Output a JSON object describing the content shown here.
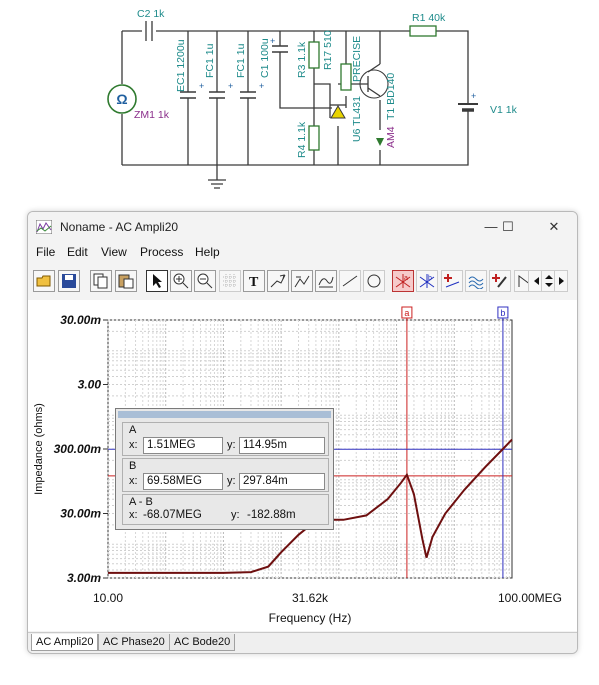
{
  "schematic": {
    "labels": {
      "c2": "C2 1k",
      "r1": "R1 40k",
      "zm1": "ZM1 1k",
      "ec1": "EC1 1200u",
      "fc1a": "FC1 1u",
      "fc1b": "FC1 1u",
      "c1": "C1 100u",
      "r3": "R3 1.1k",
      "r17": "R17 510",
      "precise": "PRECISE",
      "u6": "U6 TL431",
      "t1": "T1 BD140",
      "r4": "R4 1.1k",
      "am4": "AM4",
      "v1": "V1 1k",
      "omega": "Ω"
    }
  },
  "window": {
    "title": "Noname - AC Ampli20",
    "minimize": "—",
    "maximize": "☐",
    "close": "✕"
  },
  "menu": [
    "File",
    "Edit",
    "View",
    "Process",
    "Help"
  ],
  "toolbar_icons": [
    "open-icon",
    "save-icon",
    "copy-icon",
    "paste-icon",
    "pointer-icon",
    "zoom-in-icon",
    "zoom-out-icon",
    "grid-icon",
    "text-icon",
    "draw-icon",
    "draw2-icon",
    "curve-icon",
    "line-icon",
    "circle-icon",
    "cursor-a-icon",
    "cursor-b-icon",
    "marker-icon",
    "wave-icon",
    "probe-icon",
    "step-icon",
    "scroll-left-icon",
    "scroll-updown-icon",
    "scroll-right-icon"
  ],
  "cursor_panel": {
    "a": {
      "label": "A",
      "x_label": "x:",
      "x": "1.51MEG",
      "y_label": "y:",
      "y": "114.95m"
    },
    "b": {
      "label": "B",
      "x_label": "x:",
      "x": "69.58MEG",
      "y_label": "y:",
      "y": "297.84m"
    },
    "diff": {
      "label": "A - B",
      "x_label": "x:",
      "x": "-68.07MEG",
      "y_label": "y:",
      "y": "-182.88m"
    }
  },
  "chart_data": {
    "type": "line",
    "xlabel": "Frequency (Hz)",
    "ylabel": "Impedance (ohms)",
    "xscale": "log",
    "yscale": "log",
    "xlim": [
      10,
      100000000
    ],
    "ylim": [
      0.003,
      30
    ],
    "xticks": [
      {
        "value": 10,
        "label": "10.00"
      },
      {
        "value": 31620,
        "label": "31.62k"
      },
      {
        "value": 100000000,
        "label": "100.00MEG"
      }
    ],
    "yticks": [
      {
        "value": 30,
        "label": "30.00m"
      },
      {
        "value": 3,
        "label": "3.00"
      },
      {
        "value": 0.3,
        "label": "300.00m"
      },
      {
        "value": 0.03,
        "label": "30.00m"
      },
      {
        "value": 0.003,
        "label": "3.00m"
      }
    ],
    "series": [
      {
        "color": "#6e0f0f",
        "points": [
          [
            10,
            0.0036
          ],
          [
            30,
            0.0036
          ],
          [
            100,
            0.0036
          ],
          [
            1000,
            0.0036
          ],
          [
            3000,
            0.0037
          ],
          [
            6000,
            0.0045
          ],
          [
            10000,
            0.0075
          ],
          [
            20000,
            0.014
          ],
          [
            35000,
            0.021
          ],
          [
            60000,
            0.024
          ],
          [
            120000,
            0.024
          ],
          [
            300000,
            0.028
          ],
          [
            700000,
            0.05
          ],
          [
            1200000,
            0.09
          ],
          [
            1510000,
            0.12
          ],
          [
            2000000,
            0.06
          ],
          [
            2800000,
            0.012
          ],
          [
            3300000,
            0.0062
          ],
          [
            4200000,
            0.013
          ],
          [
            7000000,
            0.03
          ],
          [
            15000000,
            0.07
          ],
          [
            35000000,
            0.16
          ],
          [
            69580000,
            0.3
          ],
          [
            100000000,
            0.42
          ]
        ]
      }
    ],
    "cursors": [
      {
        "name": "a",
        "label": "a",
        "x": 1510000,
        "y": 0.11495,
        "color": "#cc2020"
      },
      {
        "name": "b",
        "label": "b",
        "x": 69580000,
        "y": 0.29784,
        "color": "#3030c0"
      }
    ],
    "grid": true
  },
  "tabs": [
    "AC Ampli20",
    "AC Phase20",
    "AC Bode20"
  ]
}
